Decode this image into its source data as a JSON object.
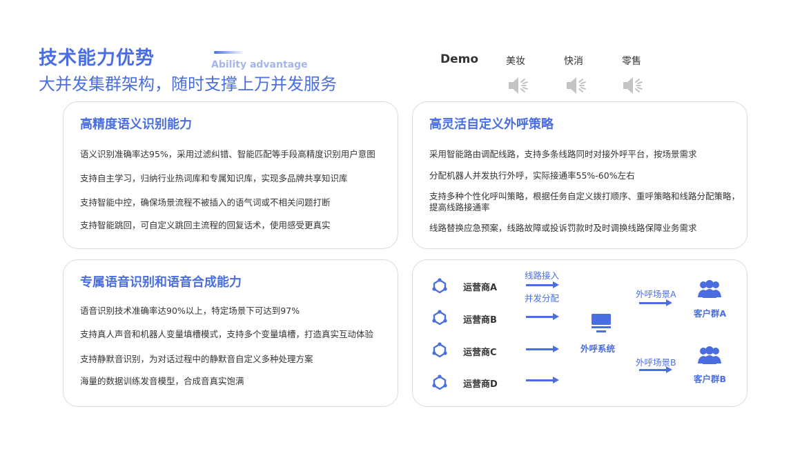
{
  "header": {
    "title": "技术能力优势",
    "subtitle": "大并发集群架构，随时支撑上万并发服务",
    "title_en": "Ability advantage"
  },
  "demo": {
    "label": "Demo",
    "items": [
      "美妆",
      "快消",
      "零售"
    ],
    "icon": "speaker-icon"
  },
  "cards": {
    "semantic": {
      "title": "高精度语义识别能力",
      "lines": [
        "语义识别准确率达95%，采用过滤纠错、智能匹配等手段高精度识别用户意图",
        "支持自主学习，归纳行业热词库和专属知识库，实现多品牌共享知识库",
        "支持智能中控，确保场景流程不被插入的语气词或不相关问题打断",
        "支持智能跳回，可自定义跳回主流程的回复话术，使用感受更真实"
      ]
    },
    "strategy": {
      "title": "高灵活自定义外呼策略",
      "lines": [
        "采用智能路由调配线路，支持多条线路同时对接外呼平台，按场景需求",
        "分配机器人并发执行外呼，实际接通率55%-60%左右",
        "支持多种个性化呼叫策略，根据任务自定义拨打顺序、重呼策略和线路分配策略，",
        "提高线路接通率",
        "线路替换应急预案，线路故障或投诉罚款时及时调换线路保障业务需求"
      ]
    },
    "speech": {
      "title": "专属语音识别和语音合成能力",
      "lines": [
        "语音识别技术准确率达90%以上，特定场景下可达到97%",
        "支持真人声音和机器人变量填槽模式，支持多个变量填槽，打造真实互动体验",
        "支持静默音识别，为对话过程中的静默音自定义多种处理方案",
        "海量的数据训练发音模型，合成音真实饱满"
      ]
    }
  },
  "diagram": {
    "operators": [
      "运营商A",
      "运营商B",
      "运营商C",
      "运营商D"
    ],
    "line_in": "线路接入",
    "concurrent": "并发分配",
    "system": "外呼系统",
    "scene_a": "外呼场景A",
    "scene_b": "外呼场景B",
    "group_a": "客户群A",
    "group_b": "客户群B",
    "colors": {
      "accent": "#4a6ee0"
    }
  }
}
